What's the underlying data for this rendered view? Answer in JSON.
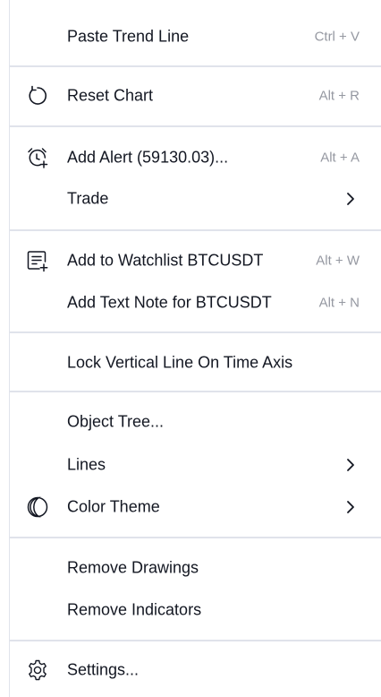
{
  "menu": {
    "paste_trend_line": {
      "label": "Paste Trend Line",
      "shortcut": "Ctrl + V"
    },
    "reset_chart": {
      "label": "Reset Chart",
      "shortcut": "Alt + R",
      "icon": "reset-icon"
    },
    "add_alert": {
      "label": "Add Alert (59130.03)...",
      "shortcut": "Alt + A",
      "icon": "alarm-clock-plus-icon"
    },
    "trade": {
      "label": "Trade",
      "icon": "chevron-right-icon"
    },
    "add_watchlist": {
      "label": "Add to Watchlist BTCUSDT",
      "shortcut": "Alt + W",
      "icon": "list-add-icon"
    },
    "add_text_note": {
      "label": "Add Text Note for BTCUSDT",
      "shortcut": "Alt + N"
    },
    "lock_vertical_line": {
      "label": "Lock Vertical Line On Time Axis"
    },
    "object_tree": {
      "label": "Object Tree..."
    },
    "lines": {
      "label": "Lines",
      "icon": "chevron-right-icon"
    },
    "color_theme": {
      "label": "Color Theme",
      "icon": "moon-icon"
    },
    "remove_drawings": {
      "label": "Remove Drawings"
    },
    "remove_indicators": {
      "label": "Remove Indicators"
    },
    "settings": {
      "label": "Settings...",
      "icon": "gear-icon"
    }
  },
  "colors": {
    "text": "#131722",
    "shortcut": "#9598a1",
    "separator": "#e0e3eb"
  }
}
